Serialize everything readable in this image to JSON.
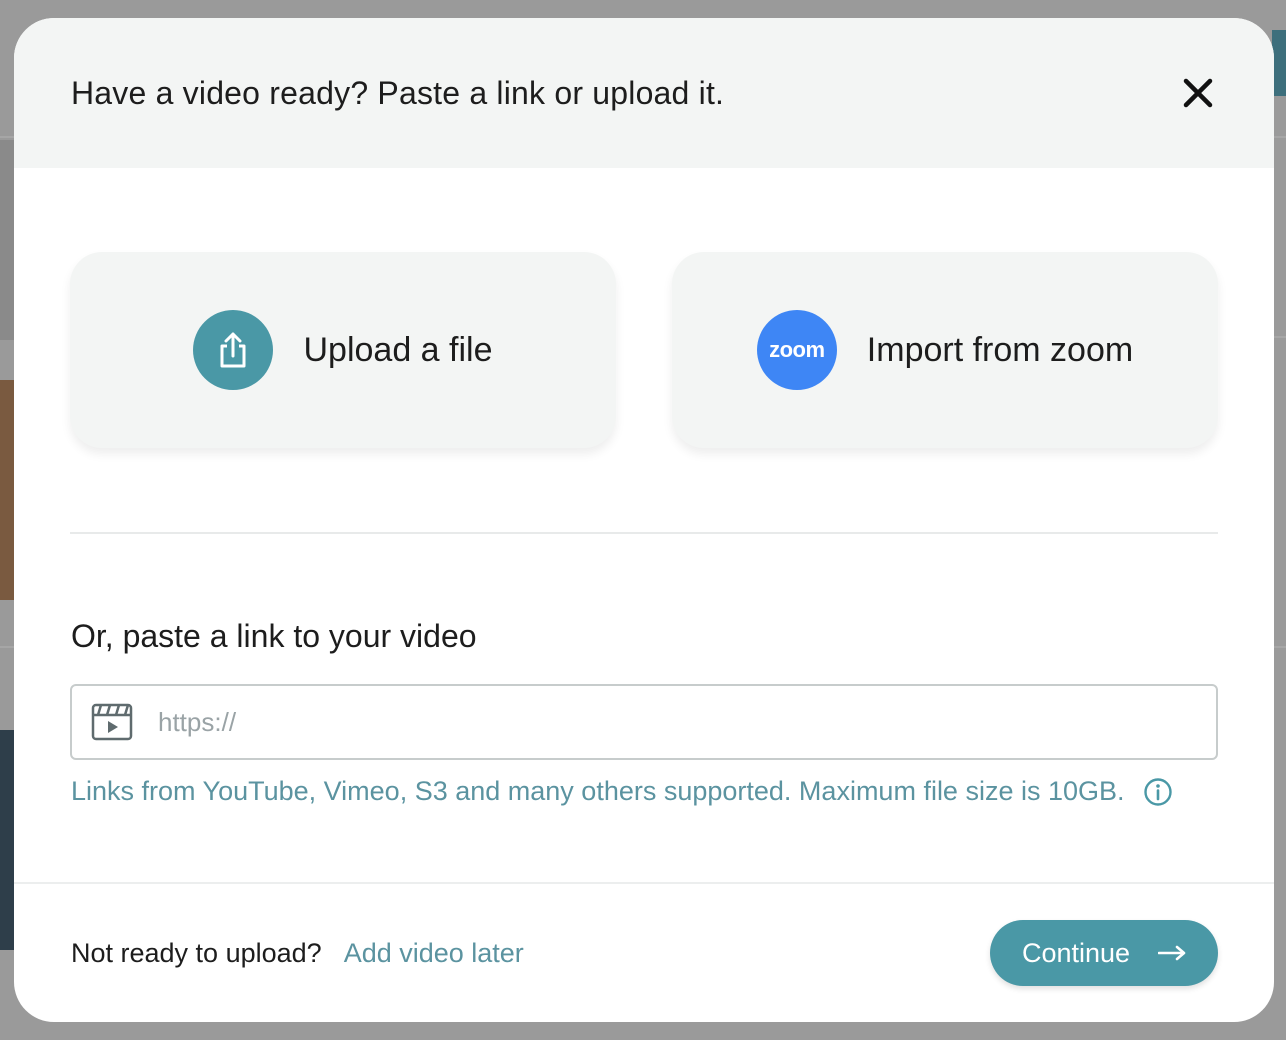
{
  "modal": {
    "title": "Have a video ready? Paste a link or upload it.",
    "close_icon": "close-icon"
  },
  "options": {
    "upload": {
      "label": "Upload a file",
      "icon": "upload-icon"
    },
    "zoom": {
      "label": "Import from zoom",
      "logo_text": "zoom",
      "icon": "zoom-logo-icon"
    }
  },
  "link": {
    "heading": "Or, paste a link to your video",
    "placeholder": "https://",
    "value": "",
    "icon": "video-clapper-icon",
    "help_text": "Links from YouTube, Vimeo, S3 and many others supported. Maximum file size is 10GB.",
    "info_icon": "info-icon"
  },
  "footer": {
    "not_ready_text": "Not ready to upload?",
    "add_later_label": "Add video later",
    "continue_label": "Continue",
    "continue_icon": "arrow-right-icon"
  },
  "colors": {
    "accent": "#4a98a6",
    "zoom_blue": "#3e86f5",
    "header_bg": "#f3f5f4",
    "link_text": "#5b93a0"
  }
}
